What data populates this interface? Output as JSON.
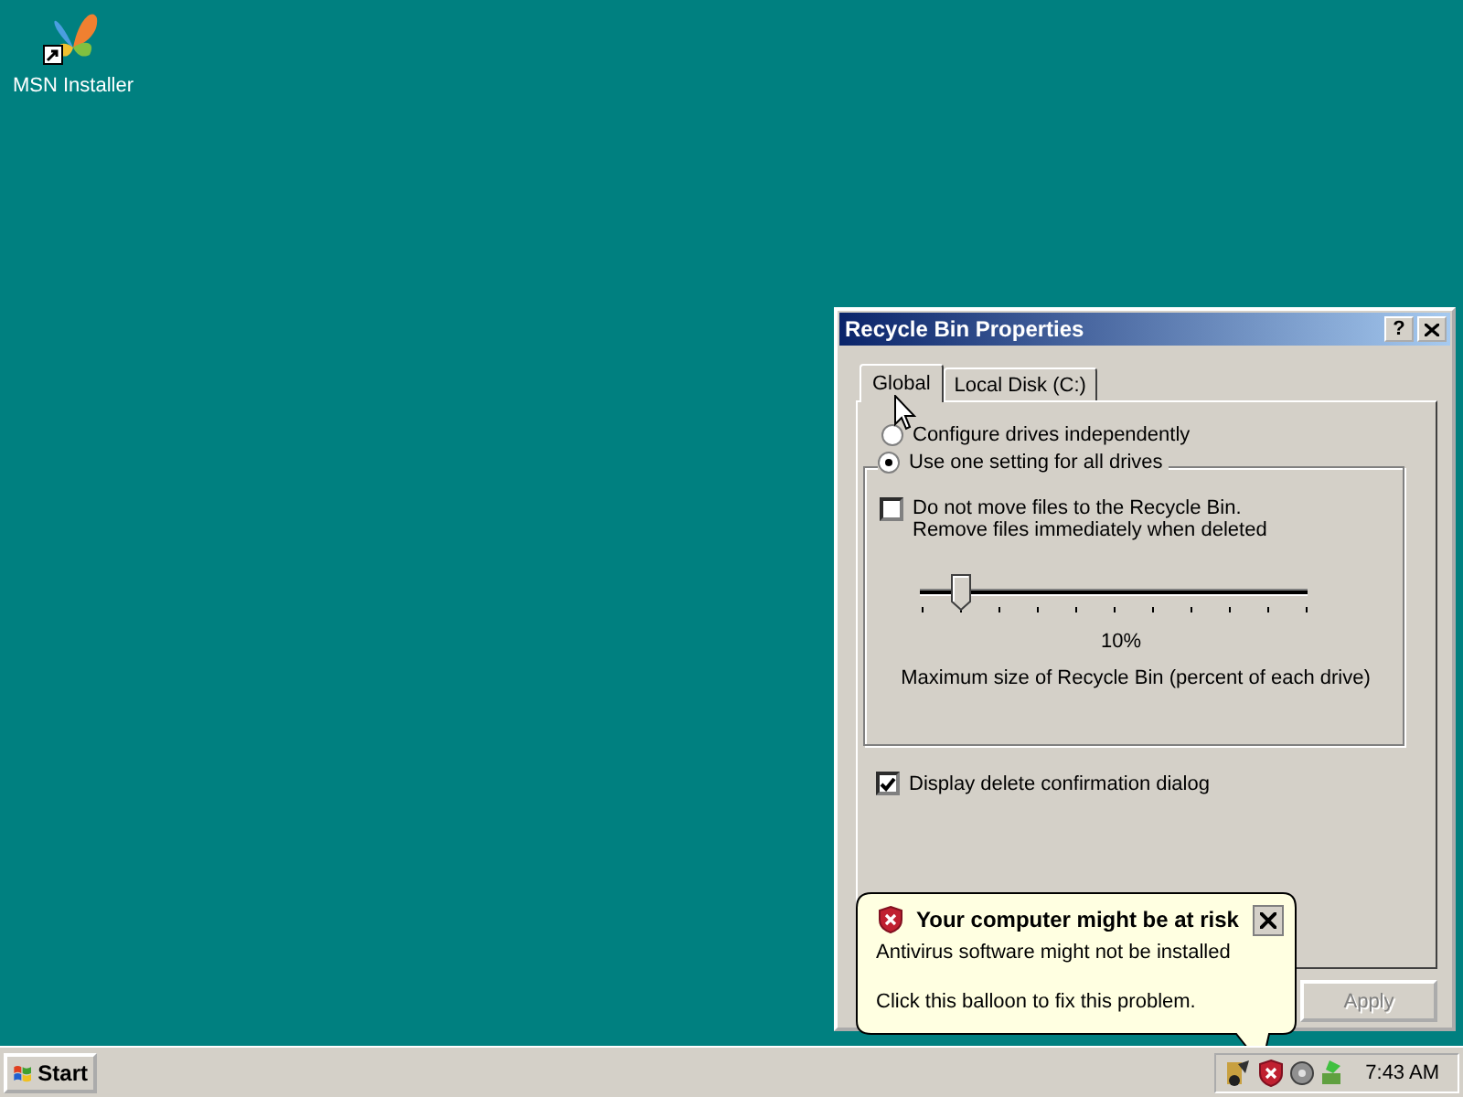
{
  "desktop": {
    "icons": [
      {
        "label": "MSN Installer"
      }
    ]
  },
  "dialog": {
    "title": "Recycle Bin Properties",
    "help_button": "?",
    "tabs": [
      {
        "label": "Global",
        "selected": true
      },
      {
        "label": "Local Disk (C:)",
        "selected": false
      }
    ],
    "options": [
      {
        "label": "Configure drives independently",
        "selected": false
      },
      {
        "label": "Use one setting for all drives",
        "selected": true
      }
    ],
    "group": {
      "checkbox": {
        "lines": [
          "Do not move files to the Recycle Bin.",
          "Remove files immediately when deleted"
        ],
        "checked": false
      },
      "slider": {
        "level": 0.1
      },
      "reading": "10%",
      "caption": "Maximum size of Recycle Bin (percent of each drive)"
    },
    "confirm": {
      "label": "Display delete confirmation dialog",
      "checked": true
    },
    "buttons": [
      {
        "label": "Apply",
        "disabled": true
      }
    ]
  },
  "balloon": {
    "title": "Your computer might be at risk",
    "lines": [
      "Antivirus software might not be installed",
      "Click this balloon to fix this problem."
    ]
  },
  "taskbar": {
    "start": "Start",
    "clock": "7:43 AM"
  }
}
